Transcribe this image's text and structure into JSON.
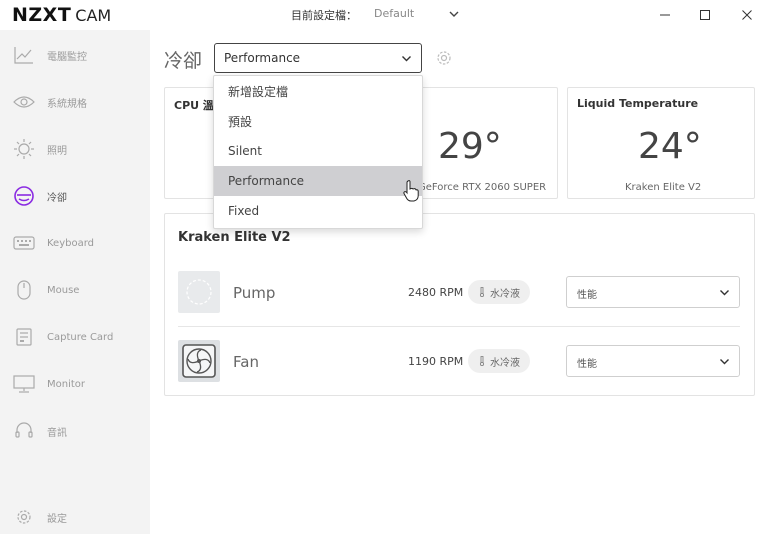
{
  "app": {
    "brand_main": "NZXT",
    "brand_sub": "CAM"
  },
  "titlebar": {
    "profile_label": "目前設定檔：",
    "profile_value": "Default"
  },
  "sidebar": {
    "items": [
      {
        "label": "電腦監控",
        "icon": "chart-icon"
      },
      {
        "label": "系統規格",
        "icon": "eye-icon"
      },
      {
        "label": "照明",
        "icon": "sun-icon"
      },
      {
        "label": "冷卻",
        "icon": "cooling-icon",
        "active": true
      },
      {
        "label": "Keyboard",
        "icon": "keyboard-icon"
      },
      {
        "label": "Mouse",
        "icon": "mouse-icon"
      },
      {
        "label": "Capture Card",
        "icon": "capture-card-icon"
      },
      {
        "label": "Monitor",
        "icon": "monitor-icon"
      },
      {
        "label": "音訊",
        "icon": "headset-icon"
      }
    ],
    "settings_label": "設定"
  },
  "main": {
    "title": "冷卻",
    "profile_select": "Performance",
    "dropdown": {
      "items": [
        "新增設定檔",
        "預設",
        "Silent",
        "Performance",
        "Fixed"
      ],
      "hovered": "Performance"
    },
    "cards": {
      "cpu": {
        "title": "CPU 溫度"
      },
      "gpu": {
        "value": "29°",
        "sub": "GeForce RTX 2060 SUPER"
      },
      "liquid": {
        "title": "Liquid Temperature",
        "value": "24°",
        "sub": "Kraken Elite V2"
      }
    },
    "device": {
      "title": "Kraken Elite V2",
      "rows": [
        {
          "name": "Pump",
          "rpm": "2480 RPM",
          "tag": "水冷液",
          "mode": "性能",
          "icon": "pump-icon"
        },
        {
          "name": "Fan",
          "rpm": "1190 RPM",
          "tag": "水冷液",
          "mode": "性能",
          "icon": "fan-icon"
        }
      ]
    }
  },
  "colors": {
    "accent": "#8a2be2",
    "sidebar_bg": "#f3f3f3",
    "hover_bg": "#cfcfd2"
  }
}
